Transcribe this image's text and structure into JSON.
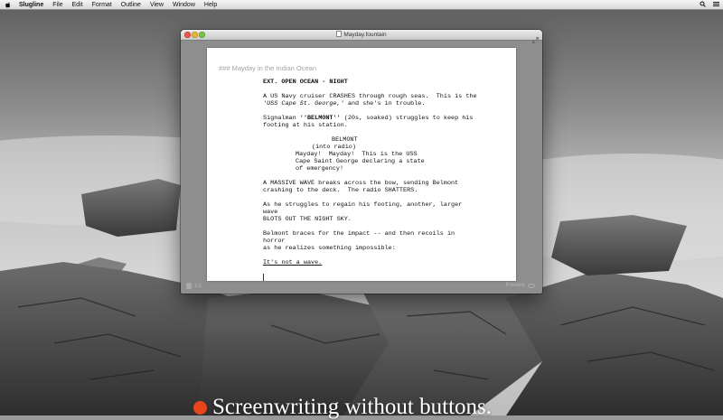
{
  "menubar": {
    "app_name": "Slugline",
    "items": [
      "File",
      "Edit",
      "Format",
      "Outline",
      "View",
      "Window",
      "Help"
    ]
  },
  "window": {
    "title": "Mayday.fountain",
    "section_heading": "### Mayday in the Indian Ocean",
    "status": {
      "page_indicator": "1/1",
      "preview_label": "Preview"
    }
  },
  "script": {
    "scene_heading": "EXT. OPEN OCEAN - NIGHT",
    "action_1_pre": "A US Navy cruiser CRASHES through rough seas.  This is the ",
    "action_1_italic": "'USS Cape St. George,'",
    "action_1_post": " and she's in trouble.",
    "action_2_pre": "Signalman ",
    "action_2_bold": "''BELMONT''",
    "action_2_post": " (20s, soaked) struggles to keep his footing at his station.",
    "character": "BELMONT",
    "parenthetical": "(into radio)",
    "dialogue": "Mayday!  Mayday!  This is the USS\nCape Saint George declaring a state\nof emergency!",
    "action_3": "A MASSIVE WAVE breaks across the bow, sending Belmont\ncrashing to the deck.  The radio SHATTERS.",
    "action_4": "As he struggles to regain his footing, another, larger wave\nBLOTS OUT THE NIGHT SKY.",
    "action_5": "Belmont braces for the impact -- and then recoils in horror\nas he realizes something impossible:",
    "underlined": "It's not a wave."
  },
  "caption": {
    "text": "Screenwriting without buttons."
  },
  "colors": {
    "accent_dot": "#e8451c",
    "page": "#ffffff",
    "window_chrome": "#8e8e8e"
  }
}
